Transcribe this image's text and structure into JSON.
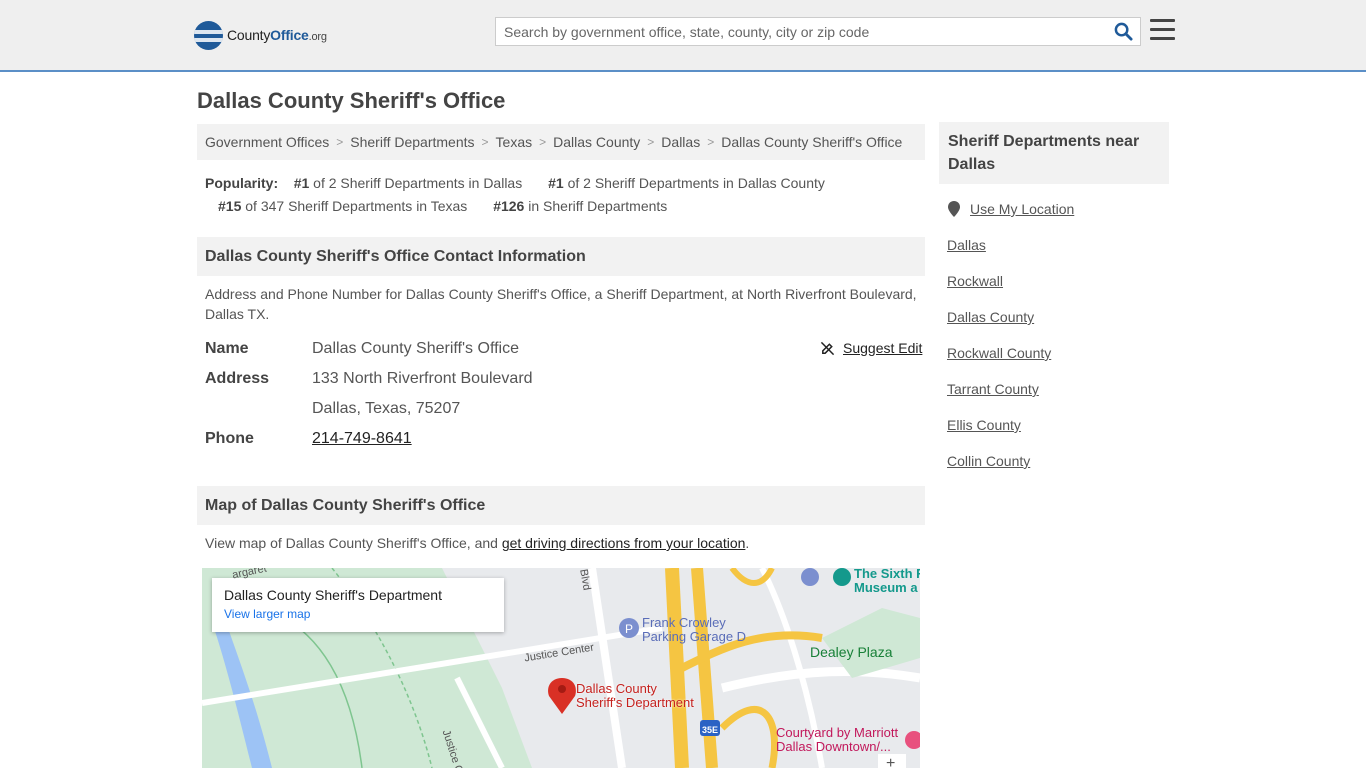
{
  "header": {
    "logo": {
      "county": "County",
      "office": "Office",
      "org": ".org"
    },
    "search": {
      "placeholder": "Search by government office, state, county, city or zip code"
    }
  },
  "page": {
    "title": "Dallas County Sheriff's Office"
  },
  "breadcrumb": [
    "Government Offices",
    "Sheriff Departments",
    "Texas",
    "Dallas County",
    "Dallas",
    "Dallas County Sheriff's Office"
  ],
  "popularity": {
    "label": "Popularity:",
    "items": [
      {
        "rank": "#1",
        "text": " of 2 Sheriff Departments in Dallas"
      },
      {
        "rank": "#1",
        "text": " of 2 Sheriff Departments in Dallas County"
      },
      {
        "rank": "#15",
        "text": " of 347 Sheriff Departments in Texas"
      },
      {
        "rank": "#126",
        "text": " in Sheriff Departments"
      }
    ]
  },
  "contact": {
    "heading": "Dallas County Sheriff's Office Contact Information",
    "description_1": "Address and Phone Number for Dallas County Sheriff's Office, a Sheriff Department, at North Riverfront Boulevard,",
    "description_2": "Dallas TX.",
    "suggest_edit": "Suggest Edit",
    "name_label": "Name",
    "name_value": "Dallas County Sheriff's Office",
    "address_label": "Address",
    "address_line1": "133 North Riverfront Boulevard",
    "address_line2": "Dallas, Texas, 75207",
    "phone_label": "Phone",
    "phone_value": "214-749-8641"
  },
  "map_section": {
    "heading": "Map of Dallas County Sheriff's Office",
    "desc_prefix": "View map of Dallas County Sheriff's Office, and ",
    "desc_link": "get driving directions from your location",
    "desc_suffix": ".",
    "card_title": "Dallas County Sheriff's Department",
    "card_link": "View larger map",
    "labels": {
      "pin_line1": "Dallas County",
      "pin_line2": "Sheriff's Department",
      "parking_line1": "Frank Crowley",
      "parking_line2": "Parking Garage D",
      "justice_center": "Justice Center",
      "justice_center_vert": "Justice Cent",
      "dealey": "Dealey Plaza",
      "sixth_line1": "The Sixth F",
      "sixth_line2": "Museum a",
      "courtyard_line1": "Courtyard by Marriott",
      "courtyard_line2": "Dallas Downtown/...",
      "blvd": "Blvd",
      "margaret": "argaret",
      "interstate": "35E"
    }
  },
  "sidebar": {
    "heading": "Sheriff Departments near Dallas",
    "use_location": "Use My Location",
    "links": [
      "Dallas",
      "Rockwall",
      "Dallas County",
      "Rockwall County",
      "Tarrant County",
      "Ellis County",
      "Collin County"
    ]
  },
  "colors": {
    "brand": "#1f5a99",
    "accent_border": "#5b8fc7",
    "map_pin": "#d93025",
    "map_poi": "#4285f4"
  }
}
